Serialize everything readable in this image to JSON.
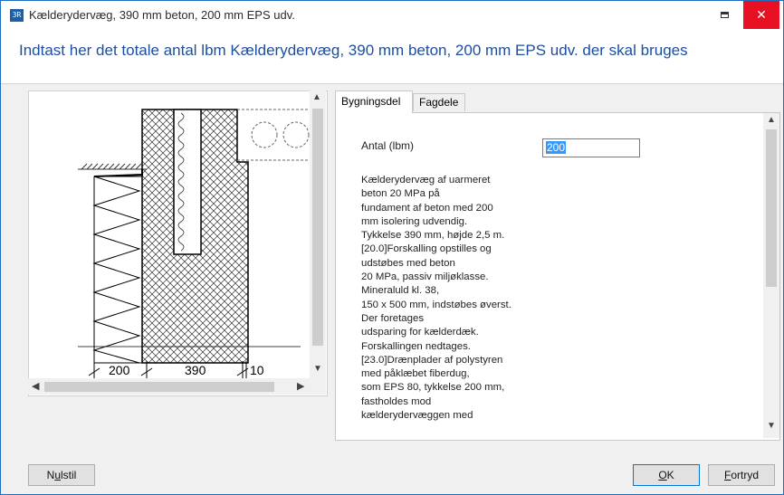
{
  "window": {
    "title": "Kælderydervæg, 390 mm beton, 200 mm EPS udv.",
    "app_icon": "app-icon",
    "app_icon_glyph": "3R",
    "close_glyph": "✕"
  },
  "header": {
    "instruction": "Indtast her det totale antal lbm Kælderydervæg, 390 mm beton, 200 mm EPS udv. der skal bruges"
  },
  "drawing": {
    "dims": [
      "200",
      "390",
      "10"
    ]
  },
  "tabs": [
    {
      "label": "Bygningsdel",
      "active": true
    },
    {
      "label": "Fagdele",
      "active": false
    }
  ],
  "form": {
    "quantity_label": "Antal (lbm)",
    "quantity_value": "200",
    "description": "Kælderydervæg af uarmeret\nbeton 20 MPa på\nfundament af beton med 200\nmm isolering udvendig.\nTykkelse 390 mm, højde 2,5 m.\n[20.0]Forskalling opstilles og\nudstøbes med beton\n20 MPa, passiv miljøklasse.\nMineraluld kl. 38,\n150 x 500 mm, indstøbes øverst.\nDer foretages\nudsparing for kælderdæk.\nForskallingen nedtages.\n[23.0]Drænplader af polystyren\nmed påklæbet fiberdug,\nsom EPS 80, tykkelse 200 mm,\nfastholdes mod\nkælderydervæggen med"
  },
  "buttons": {
    "reset_pre": "N",
    "reset_u": "u",
    "reset_post": "lstil",
    "ok_u": "O",
    "ok_post": "K",
    "cancel_u": "F",
    "cancel_post": "ortryd"
  },
  "colors": {
    "accent": "#1c4fa0",
    "close_bg": "#e81123",
    "selection": "#3399ff"
  }
}
